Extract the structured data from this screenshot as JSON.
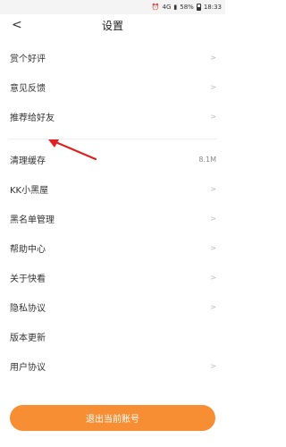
{
  "status": {
    "time": "18:33",
    "battery": "58%",
    "network": "4G"
  },
  "nav": {
    "back": "<",
    "title": "设置"
  },
  "group1": [
    {
      "label": "赏个好评",
      "chev": ">"
    },
    {
      "label": "意见反馈",
      "chev": ">"
    },
    {
      "label": "推荐给好友",
      "chev": ">"
    }
  ],
  "group2": [
    {
      "label": "清理缓存",
      "value": "8.1M"
    },
    {
      "label": "KK小黑屋",
      "chev": ">"
    },
    {
      "label": "黑名单管理",
      "chev": ">"
    },
    {
      "label": "帮助中心",
      "chev": ">"
    },
    {
      "label": "关于快看",
      "chev": ">"
    },
    {
      "label": "隐私协议",
      "chev": ">"
    },
    {
      "label": "版本更新",
      "chev": ""
    },
    {
      "label": "用户协议",
      "chev": ">"
    }
  ],
  "logout_label": "退出当前账号",
  "colors": {
    "accent": "#f88e33",
    "annotation": "#e02020"
  }
}
